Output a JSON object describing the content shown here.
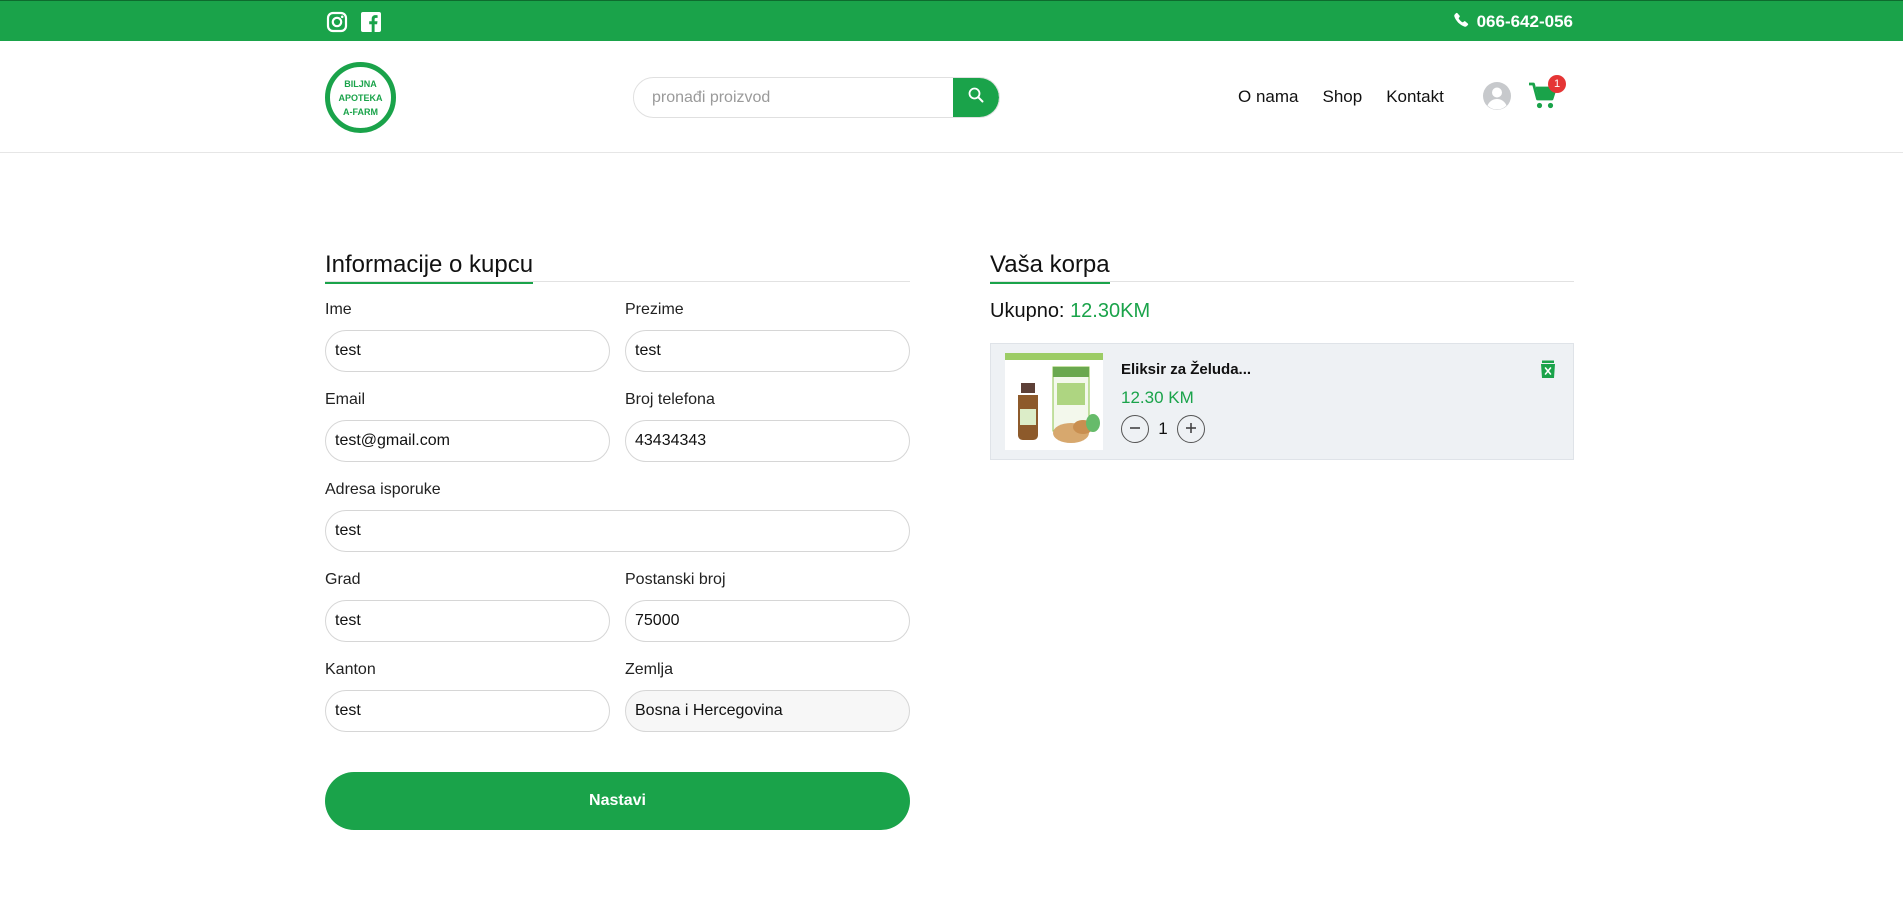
{
  "topbar": {
    "phone": "066-642-056",
    "social": [
      "instagram-icon",
      "facebook-icon"
    ]
  },
  "header": {
    "logo_lines": [
      "BILJNA",
      "APOTEKA",
      "A-FARM"
    ],
    "search_placeholder": "pronađi proizvod",
    "nav": [
      "O nama",
      "Shop",
      "Kontakt"
    ],
    "cart_count": "1"
  },
  "form": {
    "title": "Informacije o kupcu",
    "fields": {
      "ime": {
        "label": "Ime",
        "value": "test"
      },
      "prezime": {
        "label": "Prezime",
        "value": "test"
      },
      "email": {
        "label": "Email",
        "value": "test@gmail.com"
      },
      "telefon": {
        "label": "Broj telefona",
        "value": "43434343"
      },
      "adresa": {
        "label": "Adresa isporuke",
        "value": "test"
      },
      "grad": {
        "label": "Grad",
        "value": "test"
      },
      "postanski": {
        "label": "Postanski broj",
        "value": "75000"
      },
      "kanton": {
        "label": "Kanton",
        "value": "test"
      },
      "zemlja": {
        "label": "Zemlja",
        "value": "Bosna i Hercegovina"
      }
    },
    "submit_label": "Nastavi"
  },
  "cart": {
    "title": "Vaša korpa",
    "total_label": "Ukupno: ",
    "total_value": "12.30KM",
    "items": [
      {
        "name": "Eliksir za Želuda...",
        "price": "12.30 KM",
        "quantity": "1"
      }
    ]
  },
  "colors": {
    "accent": "#1aa34a",
    "badge": "#e53535"
  }
}
